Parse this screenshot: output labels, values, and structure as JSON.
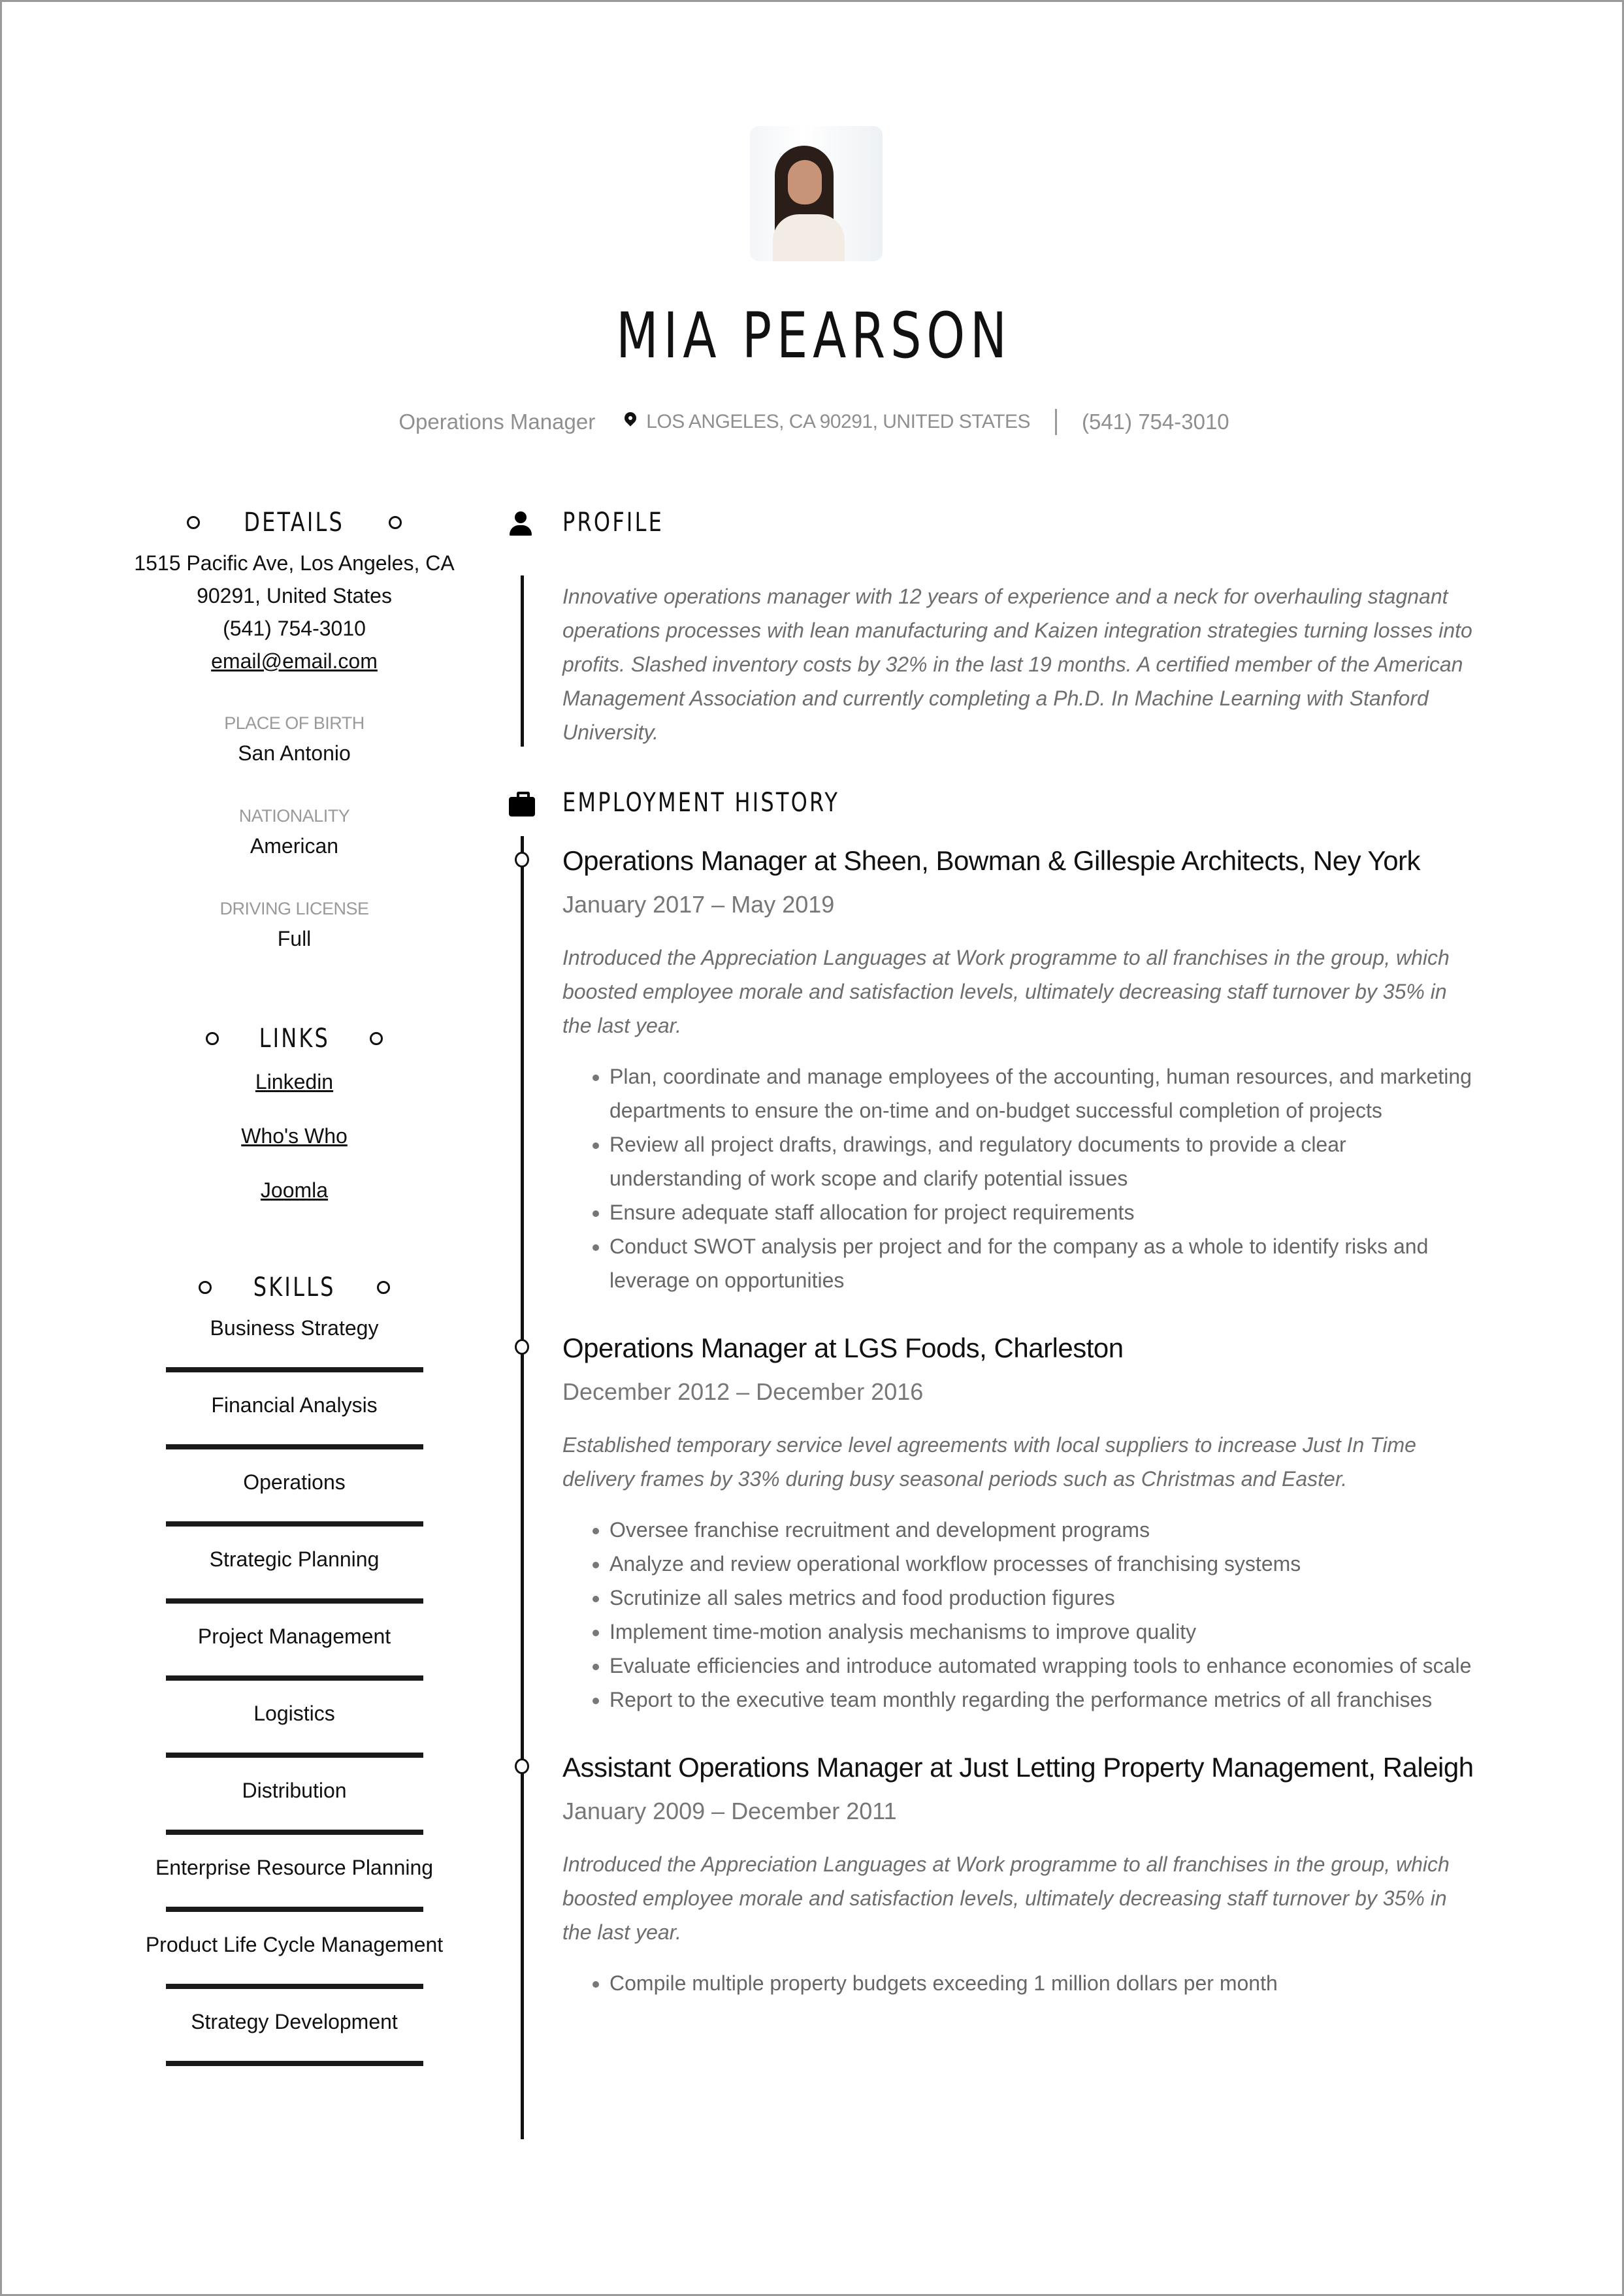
{
  "header": {
    "name": "MIA PEARSON",
    "job_title": "Operations Manager",
    "location": "LOS ANGELES, CA 90291, UNITED STATES",
    "phone": "(541) 754-3010",
    "icons": {
      "location": "map-pin-icon",
      "photo": "profile-photo"
    }
  },
  "details": {
    "heading": "DETAILS",
    "address_line1": "1515 Pacific Ave, Los Angeles, CA",
    "address_line2": "90291, United States",
    "phone": "(541) 754-3010",
    "email": "email@email.com",
    "fields": [
      {
        "label": "PLACE OF BIRTH",
        "value": "San Antonio"
      },
      {
        "label": "NATIONALITY",
        "value": "American"
      },
      {
        "label": "DRIVING LICENSE",
        "value": "Full"
      }
    ]
  },
  "links": {
    "heading": "LINKS",
    "items": [
      "Linkedin",
      "Who's Who",
      "Joomla"
    ]
  },
  "skills": {
    "heading": "SKILLS",
    "items": [
      {
        "name": "Business Strategy",
        "level": 1.0
      },
      {
        "name": "Financial Analysis",
        "level": 1.0
      },
      {
        "name": "Operations",
        "level": 1.0
      },
      {
        "name": "Strategic Planning",
        "level": 1.0
      },
      {
        "name": "Project Management",
        "level": 1.0
      },
      {
        "name": "Logistics",
        "level": 1.0
      },
      {
        "name": "Distribution",
        "level": 1.0
      },
      {
        "name": "Enterprise Resource Planning",
        "level": 1.0
      },
      {
        "name": "Product Life Cycle Management",
        "level": 1.0
      },
      {
        "name": "Strategy Development",
        "level": 1.0
      }
    ]
  },
  "profile": {
    "heading": "PROFILE",
    "icon": "person-icon",
    "text": "Innovative operations manager with 12 years of experience and a neck for overhauling stagnant operations processes with lean manufacturing and Kaizen integration strategies turning losses into profits. Slashed inventory costs by 32% in the last 19 months. A certified member of the American Management Association and currently completing a Ph.D. In Machine Learning with Stanford University."
  },
  "employment": {
    "heading": "EMPLOYMENT HISTORY",
    "icon": "briefcase-icon",
    "jobs": [
      {
        "title": "Operations Manager at Sheen, Bowman & Gillespie Architects, Ney York",
        "dates": "January 2017 – May 2019",
        "summary": "Introduced the Appreciation Languages at Work programme to all franchises in the group, which boosted employee morale and satisfaction levels, ultimately decreasing staff turnover by 35% in the last year.",
        "bullets": [
          "Plan, coordinate and manage employees of the accounting, human resources, and marketing departments to ensure the on-time and on-budget successful completion of projects",
          "Review all project drafts, drawings, and regulatory documents to provide a clear understanding of work scope and clarify potential issues",
          "Ensure adequate staff allocation for project requirements",
          "Conduct SWOT analysis per project and for the company as a whole to identify risks and leverage on opportunities"
        ]
      },
      {
        "title": "Operations Manager at LGS Foods, Charleston",
        "dates": "December 2012 – December 2016",
        "summary": "Established temporary service level agreements with local suppliers to increase Just In Time delivery frames by 33% during busy seasonal periods such as Christmas and Easter.",
        "bullets": [
          "Oversee franchise recruitment and development programs",
          "Analyze and review operational workflow processes of franchising systems",
          "Scrutinize all sales metrics and food production figures",
          "Implement time-motion analysis mechanisms to improve quality",
          "Evaluate efficiencies and introduce automated wrapping tools to enhance economies of scale",
          "Report to the executive team monthly regarding the performance metrics of all franchises"
        ]
      },
      {
        "title": "Assistant Operations Manager at Just Letting Property Management, Raleigh",
        "dates": "January 2009 – December 2011",
        "summary": "Introduced the Appreciation Languages at Work programme to all franchises in the group, which boosted employee morale and satisfaction levels, ultimately decreasing staff turnover by 35% in the last year.",
        "bullets": [
          "Compile multiple property budgets exceeding 1 million dollars per month"
        ]
      }
    ]
  },
  "colors": {
    "text": "#111111",
    "muted": "#8f8f8f",
    "body": "#6e6e6e",
    "border": "#9a9a9a"
  }
}
